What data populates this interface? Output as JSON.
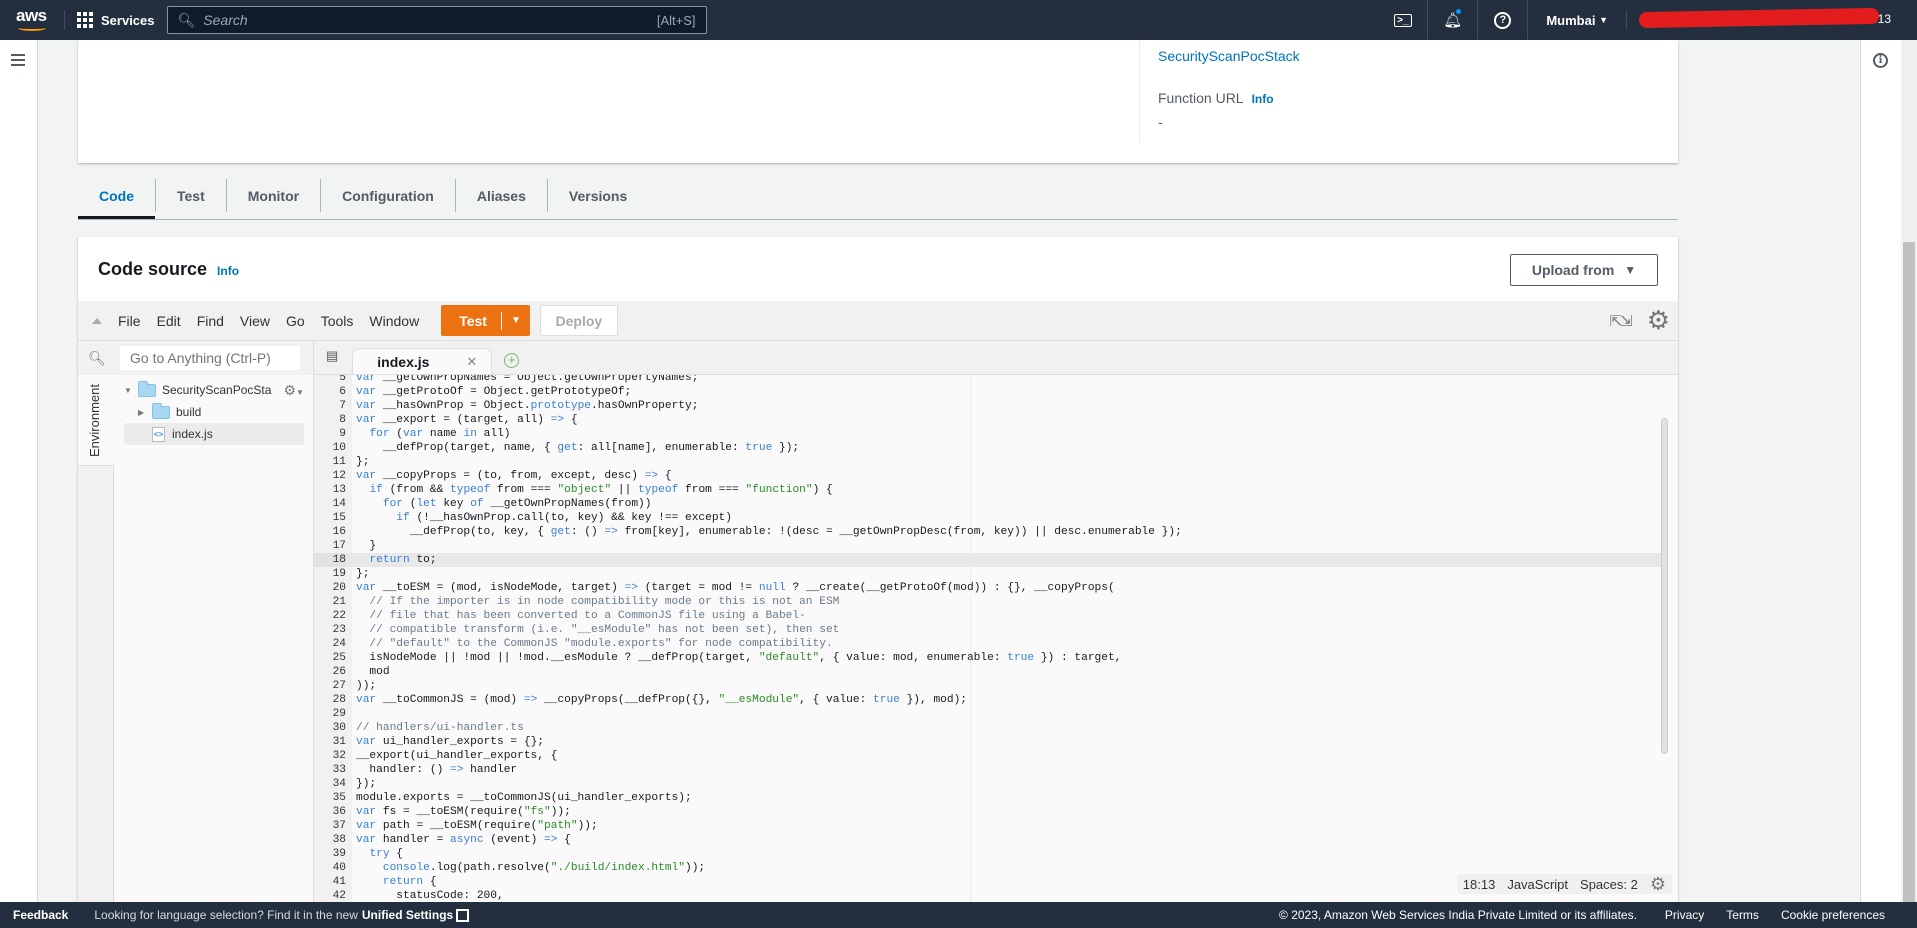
{
  "topnav": {
    "logo": "aws",
    "services_label": "Services",
    "search_placeholder": "Search",
    "search_shortcut": "[Alt+S]",
    "icons": [
      "cloudshell-icon",
      "bell-icon",
      "help-icon"
    ],
    "region_label": "Mumbai",
    "account_partial": "0243-0013"
  },
  "overview": {
    "stack_link": "SecurityScanPocStack",
    "function_url_label": "Function URL",
    "function_url_info": "Info",
    "function_url_value": "-"
  },
  "tabs": [
    {
      "label": "Code",
      "active": true
    },
    {
      "label": "Test",
      "active": false
    },
    {
      "label": "Monitor",
      "active": false
    },
    {
      "label": "Configuration",
      "active": false
    },
    {
      "label": "Aliases",
      "active": false
    },
    {
      "label": "Versions",
      "active": false
    }
  ],
  "code_source": {
    "title": "Code source",
    "info": "Info",
    "upload_label": "Upload from"
  },
  "ide": {
    "menu": [
      "File",
      "Edit",
      "Find",
      "View",
      "Go",
      "Tools",
      "Window"
    ],
    "test_label": "Test",
    "deploy_label": "Deploy",
    "goto_placeholder": "Go to Anything (Ctrl-P)",
    "environment_label": "Environment",
    "tree": [
      {
        "name": "SecurityScanPocSta",
        "type": "folder",
        "expanded": true
      },
      {
        "name": "build",
        "type": "folder",
        "expanded": false
      },
      {
        "name": "index.js",
        "type": "file",
        "selected": true
      }
    ],
    "open_tab": "index.js",
    "status": {
      "cursor": "18:13",
      "language": "JavaScript",
      "spaces": "Spaces: 2"
    },
    "current_line": 18,
    "code_lines": [
      {
        "n": 5,
        "t": "var __getOwnPropNames = Object.getOwnPropertyNames;"
      },
      {
        "n": 6,
        "t": "var __getProtoOf = Object.getPrototypeOf;"
      },
      {
        "n": 7,
        "t": "var __hasOwnProp = Object.prototype.hasOwnProperty;"
      },
      {
        "n": 8,
        "t": "var __export = (target, all) => {"
      },
      {
        "n": 9,
        "t": "  for (var name in all)"
      },
      {
        "n": 10,
        "t": "    __defProp(target, name, { get: all[name], enumerable: true });"
      },
      {
        "n": 11,
        "t": "};"
      },
      {
        "n": 12,
        "t": "var __copyProps = (to, from, except, desc) => {"
      },
      {
        "n": 13,
        "t": "  if (from && typeof from === \"object\" || typeof from === \"function\") {"
      },
      {
        "n": 14,
        "t": "    for (let key of __getOwnPropNames(from))"
      },
      {
        "n": 15,
        "t": "      if (!__hasOwnProp.call(to, key) && key !== except)"
      },
      {
        "n": 16,
        "t": "        __defProp(to, key, { get: () => from[key], enumerable: !(desc = __getOwnPropDesc(from, key)) || desc.enumerable });"
      },
      {
        "n": 17,
        "t": "  }"
      },
      {
        "n": 18,
        "t": "  return to;"
      },
      {
        "n": 19,
        "t": "};"
      },
      {
        "n": 20,
        "t": "var __toESM = (mod, isNodeMode, target) => (target = mod != null ? __create(__getProtoOf(mod)) : {}, __copyProps("
      },
      {
        "n": 21,
        "t": "  // If the importer is in node compatibility mode or this is not an ESM"
      },
      {
        "n": 22,
        "t": "  // file that has been converted to a CommonJS file using a Babel-"
      },
      {
        "n": 23,
        "t": "  // compatible transform (i.e. \"__esModule\" has not been set), then set"
      },
      {
        "n": 24,
        "t": "  // \"default\" to the CommonJS \"module.exports\" for node compatibility."
      },
      {
        "n": 25,
        "t": "  isNodeMode || !mod || !mod.__esModule ? __defProp(target, \"default\", { value: mod, enumerable: true }) : target,"
      },
      {
        "n": 26,
        "t": "  mod"
      },
      {
        "n": 27,
        "t": "));"
      },
      {
        "n": 28,
        "t": "var __toCommonJS = (mod) => __copyProps(__defProp({}, \"__esModule\", { value: true }), mod);"
      },
      {
        "n": 29,
        "t": ""
      },
      {
        "n": 30,
        "t": "// handlers/ui-handler.ts"
      },
      {
        "n": 31,
        "t": "var ui_handler_exports = {};"
      },
      {
        "n": 32,
        "t": "__export(ui_handler_exports, {"
      },
      {
        "n": 33,
        "t": "  handler: () => handler"
      },
      {
        "n": 34,
        "t": "});"
      },
      {
        "n": 35,
        "t": "module.exports = __toCommonJS(ui_handler_exports);"
      },
      {
        "n": 36,
        "t": "var fs = __toESM(require(\"fs\"));"
      },
      {
        "n": 37,
        "t": "var path = __toESM(require(\"path\"));"
      },
      {
        "n": 38,
        "t": "var handler = async (event) => {"
      },
      {
        "n": 39,
        "t": "  try {"
      },
      {
        "n": 40,
        "t": "    console.log(path.resolve(\"./build/index.html\"));"
      },
      {
        "n": 41,
        "t": "    return {"
      },
      {
        "n": 42,
        "t": "      statusCode: 200,"
      }
    ]
  },
  "footer": {
    "feedback": "Feedback",
    "language_msg": "Looking for language selection? Find it in the new",
    "unified_settings": "Unified Settings",
    "copyright": "© 2023, Amazon Web Services India Private Limited or its affiliates.",
    "links": [
      "Privacy",
      "Terms",
      "Cookie preferences"
    ]
  },
  "colors": {
    "nav_bg": "#232f3e",
    "link": "#0073bb",
    "primary_orange": "#ec7211"
  }
}
